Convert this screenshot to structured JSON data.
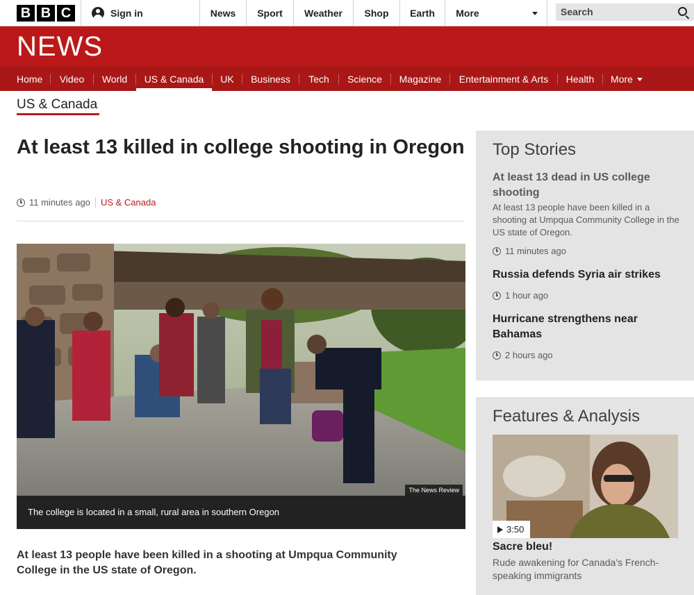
{
  "topbar": {
    "logo_letters": [
      "B",
      "B",
      "C"
    ],
    "signin_label": "Sign in",
    "nav": [
      "News",
      "Sport",
      "Weather",
      "Shop",
      "Earth",
      "More"
    ],
    "search_placeholder": "Search"
  },
  "header": {
    "brand": "NEWS"
  },
  "nav": {
    "items": [
      "Home",
      "Video",
      "World",
      "US & Canada",
      "UK",
      "Business",
      "Tech",
      "Science",
      "Magazine",
      "Entertainment & Arts",
      "Health",
      "More"
    ],
    "active": "US & Canada"
  },
  "section": {
    "title": "US & Canada"
  },
  "article": {
    "headline": "At least 13 killed in college shooting in Oregon",
    "time": "11 minutes ago",
    "section_link": "US & Canada",
    "photo_credit": "The News Review",
    "caption": "The college is located in a small, rural area in southern Oregon",
    "lede": "At least 13 people have been killed in a shooting at Umpqua Community College in the US state of Oregon."
  },
  "top_stories": {
    "title": "Top Stories",
    "items": [
      {
        "title": "At least 13 dead in US college shooting",
        "summary": "At least 13 people have been killed in a shooting at Umpqua Community College in the US state of Oregon.",
        "time": "11 minutes ago"
      },
      {
        "title": "Russia defends Syria air strikes",
        "time": "1 hour ago"
      },
      {
        "title": "Hurricane strengthens near Bahamas",
        "time": "2 hours ago"
      }
    ]
  },
  "features": {
    "title": "Features & Analysis",
    "video_duration": "3:50",
    "item_title": "Sacre bleu!",
    "item_summary": "Rude awakening for Canada's French-speaking immigrants"
  },
  "colors": {
    "brand_red": "#bb1919",
    "nav_red": "#a91717",
    "panel_grey": "#e4e4e4"
  }
}
